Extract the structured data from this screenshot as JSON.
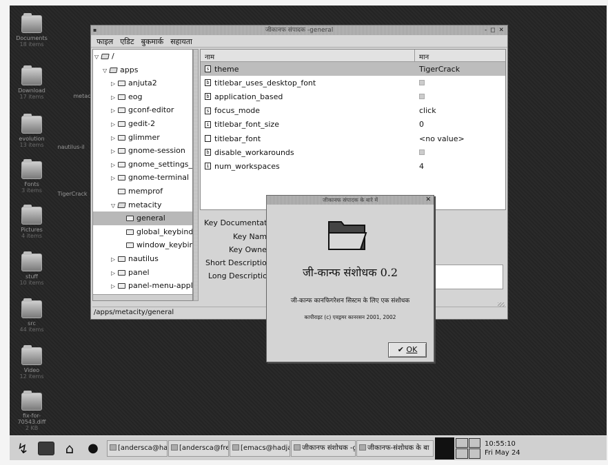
{
  "desktop_icons": [
    {
      "label": "Documents",
      "sub": "18 items"
    },
    {
      "label": "Download",
      "sub": "17 items"
    },
    {
      "label": "evolution",
      "sub": "13 items"
    },
    {
      "label": "Fonts",
      "sub": "3 items"
    },
    {
      "label": "Pictures",
      "sub": "4 items"
    },
    {
      "label": "stuff",
      "sub": "10 items"
    },
    {
      "label": "src",
      "sub": "44 items"
    },
    {
      "label": "Video",
      "sub": "12 items"
    },
    {
      "label": "fix-for-70543.diff",
      "sub": "2 KB"
    }
  ],
  "desktop_labels": {
    "metacity": "metacity",
    "nautilus": "nautilus-il",
    "tigercrack": "TigerCrack"
  },
  "gconf_window": {
    "title": "जीकानफ संपादक -general",
    "titlebar_buttons": "- ◻ ✕",
    "menu": [
      "फाइल",
      "एडिट",
      "बुकमार्क",
      "सहायता"
    ],
    "tree": [
      {
        "label": "/",
        "toggle": "▽",
        "open": true,
        "indent": 0
      },
      {
        "label": "apps",
        "toggle": "▽",
        "open": true,
        "indent": 1
      },
      {
        "label": "anjuta2",
        "toggle": "▷",
        "open": false,
        "indent": 2
      },
      {
        "label": "eog",
        "toggle": "▷",
        "open": false,
        "indent": 2
      },
      {
        "label": "gconf-editor",
        "toggle": "▷",
        "open": false,
        "indent": 2
      },
      {
        "label": "gedit-2",
        "toggle": "▷",
        "open": false,
        "indent": 2
      },
      {
        "label": "glimmer",
        "toggle": "▷",
        "open": false,
        "indent": 2
      },
      {
        "label": "gnome-session",
        "toggle": "▷",
        "open": false,
        "indent": 2
      },
      {
        "label": "gnome_settings_d",
        "toggle": "▷",
        "open": false,
        "indent": 2
      },
      {
        "label": "gnome-terminal",
        "toggle": "▷",
        "open": false,
        "indent": 2
      },
      {
        "label": "memprof",
        "toggle": "",
        "open": false,
        "indent": 2
      },
      {
        "label": "metacity",
        "toggle": "▽",
        "open": true,
        "indent": 2
      },
      {
        "label": "general",
        "toggle": "",
        "open": false,
        "indent": 3,
        "selected": true
      },
      {
        "label": "global_keybindi",
        "toggle": "",
        "open": false,
        "indent": 3
      },
      {
        "label": "window_keybin",
        "toggle": "",
        "open": false,
        "indent": 3
      },
      {
        "label": "nautilus",
        "toggle": "▷",
        "open": false,
        "indent": 2
      },
      {
        "label": "panel",
        "toggle": "▷",
        "open": false,
        "indent": 2
      },
      {
        "label": "panel-menu-apple",
        "toggle": "▷",
        "open": false,
        "indent": 2
      }
    ],
    "keys_header": {
      "name": "नाम",
      "value": "मान"
    },
    "keys": [
      {
        "name": "theme",
        "type": "s",
        "value": "TigerCrack",
        "selected": true
      },
      {
        "name": "titlebar_uses_desktop_font",
        "type": "b",
        "value": "",
        "checkbox": true
      },
      {
        "name": "application_based",
        "type": "b",
        "value": "",
        "checkbox": true
      },
      {
        "name": "focus_mode",
        "type": "s",
        "value": "click"
      },
      {
        "name": "titlebar_font_size",
        "type": "i",
        "value": "0"
      },
      {
        "name": "titlebar_font",
        "type": "",
        "value": "<no value>"
      },
      {
        "name": "disable_workarounds",
        "type": "b",
        "value": "",
        "checkbox": true
      },
      {
        "name": "num_workspaces",
        "type": "i",
        "value": "4"
      }
    ],
    "doc": {
      "section": "Key Documentatio",
      "key_name": "Key Name:",
      "key_owner": "Key Owner:",
      "short_desc": "Short Description:",
      "long_desc": "Long Description:"
    },
    "status": "/apps/metacity/general"
  },
  "about_dialog": {
    "title": "जीकानफ संपादक के बारे में",
    "close": "✕",
    "name": "जी-कान्फ संशोधक 0.2",
    "comment": "जी-कान्फ कानफिगरेशन सिस्टम के लिए एक संशोधक",
    "copyright": "कापीराइट (c) एवड्रमर कानरसन 2001, 2002",
    "ok_label": "OK"
  },
  "panel": {
    "tasks": [
      "[andersca@hadjaha",
      "[andersca@freedom",
      "[emacs@hadjaha.h",
      "जीकानफ संशोधक -gen",
      "जीकानफ-संशोधक के बा"
    ],
    "clock_time": "10:55:10",
    "clock_date": "Fri May 24"
  }
}
